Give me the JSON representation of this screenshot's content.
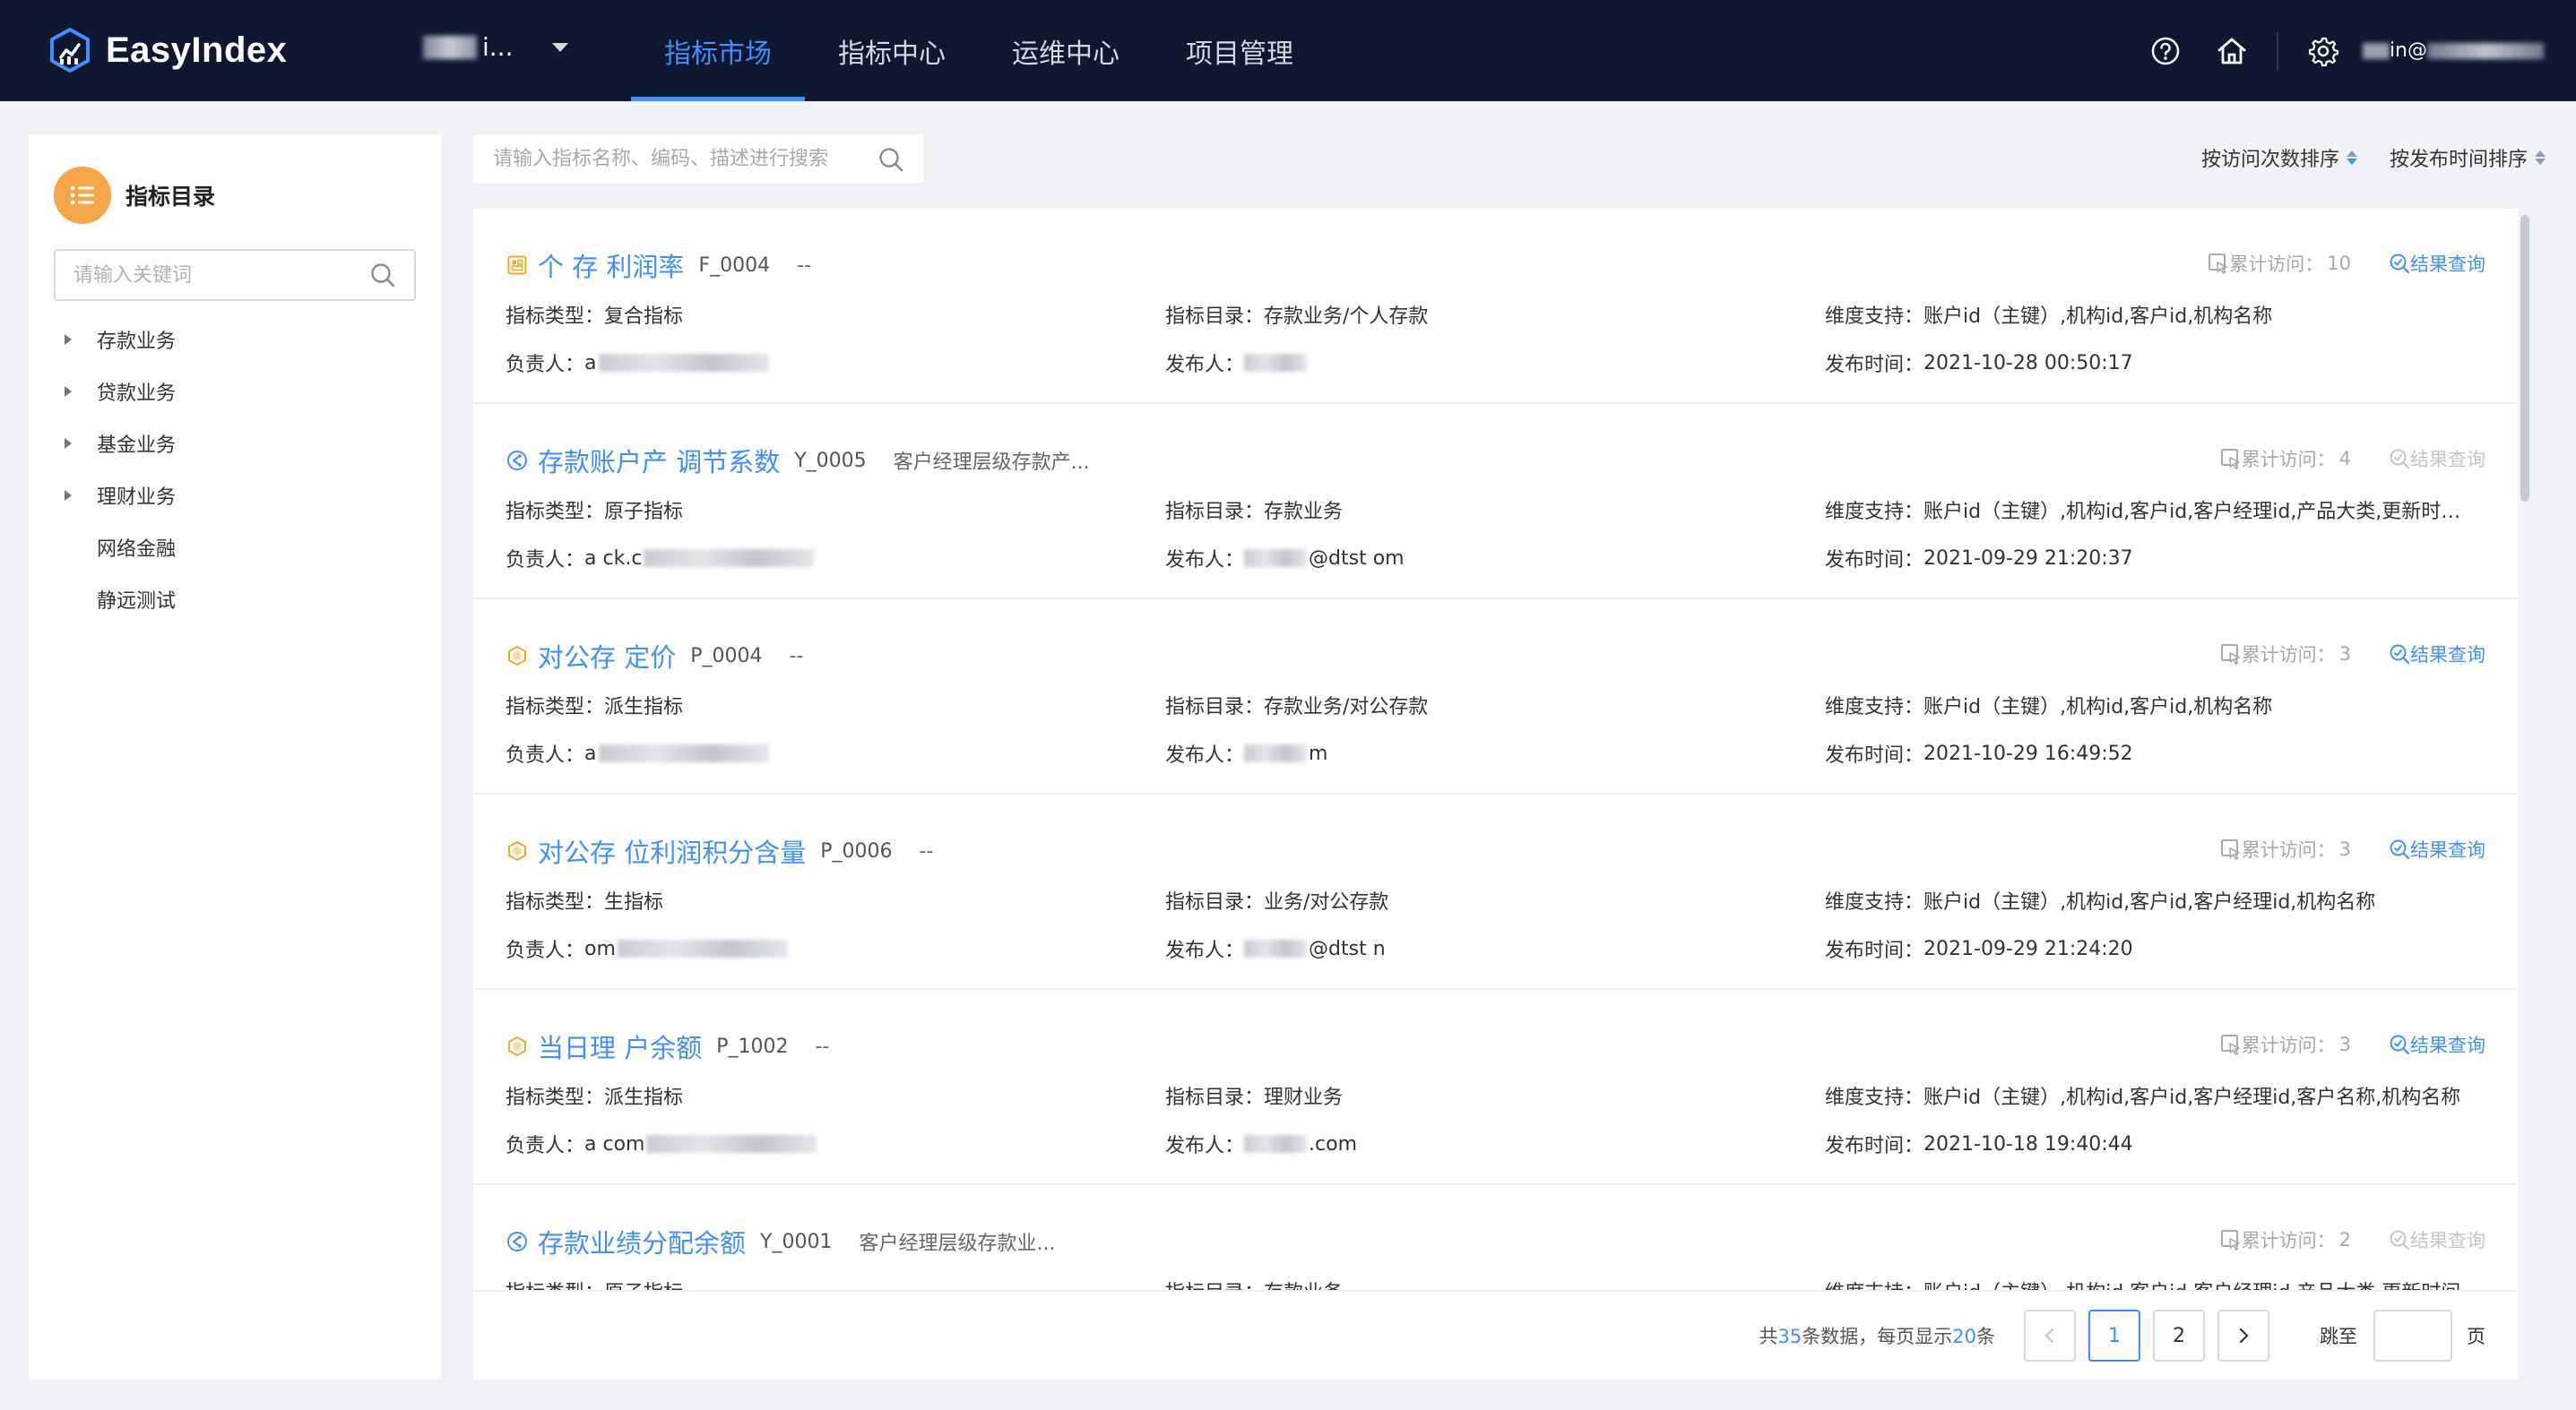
{
  "app": {
    "name": "EasyIndex",
    "tenant_label": "i...",
    "user_label": "in@"
  },
  "nav": {
    "tabs": [
      {
        "label": "指标市场",
        "active": true
      },
      {
        "label": "指标中心",
        "active": false
      },
      {
        "label": "运维中心",
        "active": false
      },
      {
        "label": "项目管理",
        "active": false
      }
    ]
  },
  "sidebar": {
    "title": "指标目录",
    "search_placeholder": "请输入关键词",
    "items": [
      {
        "label": "存款业务",
        "expandable": true
      },
      {
        "label": "贷款业务",
        "expandable": true
      },
      {
        "label": "基金业务",
        "expandable": true
      },
      {
        "label": "理财业务",
        "expandable": true
      },
      {
        "label": "网络金融",
        "expandable": false
      },
      {
        "label": "静远测试",
        "expandable": false
      }
    ]
  },
  "main": {
    "search_placeholder": "请输入指标名称、编码、描述进行搜索",
    "sort_by_visits": "按访问次数排序",
    "sort_by_publish": "按发布时间排序"
  },
  "labels": {
    "type": "指标类型：",
    "catalog": "指标目录：",
    "dims": "维度支持：",
    "owner": "负责人：",
    "publisher": "发布人：",
    "publish_time": "发布时间：",
    "visits": "累计访问：",
    "query": "结果查询"
  },
  "indicators": [
    {
      "icon": "composite-indicator-icon",
      "icon_color": "#f5a623",
      "name": "个  存   利润率",
      "code": "F_0004",
      "desc": "--",
      "visits": "10",
      "query_enabled": true,
      "type": "复合指标",
      "catalog": "存款业务/个人存款",
      "dims": "账户id（主键）,机构id,客户id,机构名称",
      "owner": "a",
      "publisher": "",
      "publish_time": "2021-10-28 00:50:17"
    },
    {
      "icon": "atomic-indicator-icon",
      "icon_color": "#3f8ffd",
      "name": "存款账户产   调节系数",
      "code": "Y_0005",
      "desc": "客户经理层级存款产...",
      "visits": "4",
      "query_enabled": false,
      "type": "原子指标",
      "catalog": "存款业务",
      "dims": "账户id（主键）,机构id,客户id,客户经理id,产品大类,更新时间,...",
      "owner": "a          ck.c",
      "publisher": "@dtst      om",
      "publish_time": "2021-09-29 21:20:37"
    },
    {
      "icon": "derived-indicator-icon",
      "icon_color": "#f5a623",
      "name": "对公存   定价",
      "code": "P_0004",
      "desc": "--",
      "visits": "3",
      "query_enabled": true,
      "type": "派生指标",
      "catalog": "存款业务/对公存款",
      "dims": "账户id（主键）,机构id,客户id,机构名称",
      "owner": "a",
      "publisher": "m",
      "publish_time": "2021-10-29 16:49:52"
    },
    {
      "icon": "derived-indicator-icon",
      "icon_color": "#f5a623",
      "name": "对公存  位利润积分含量",
      "code": "P_0006",
      "desc": "--",
      "visits": "3",
      "query_enabled": true,
      "type": "生指标",
      "catalog": "业务/对公存款",
      "dims": "账户id（主键）,机构id,客户id,客户经理id,机构名称",
      "owner": "om",
      "publisher": "@dtst     n",
      "publish_time": "2021-09-29 21:24:20"
    },
    {
      "icon": "derived-indicator-icon",
      "icon_color": "#f5a623",
      "name": "当日理   户余额",
      "code": "P_1002",
      "desc": "--",
      "visits": "3",
      "query_enabled": true,
      "type": "派生指标",
      "catalog": "理财业务",
      "dims": "账户id（主键）,机构id,客户id,客户经理id,客户名称,机构名称",
      "owner": "a    com",
      "publisher": "   .com",
      "publish_time": "2021-10-18 19:40:44"
    },
    {
      "icon": "atomic-indicator-icon",
      "icon_color": "#3f8ffd",
      "name": "存款业绩分配余额",
      "code": "Y_0001",
      "desc": "客户经理层级存款业...",
      "visits": "2",
      "query_enabled": false,
      "type": "原子指标",
      "catalog": "存款业务",
      "dims": "账户id（主键）,机构id,客户id,客户经理id,产品大类,更新时间",
      "owner": "",
      "publisher": "",
      "publish_time": ""
    }
  ],
  "pagination": {
    "total_prefix": "共",
    "total": "35",
    "total_mid": "条数据，每页显示",
    "page_size": "20",
    "total_suffix": "条",
    "pages": [
      "1",
      "2"
    ],
    "current_page": "1",
    "jump_label": "跳至",
    "page_suffix": "页"
  }
}
